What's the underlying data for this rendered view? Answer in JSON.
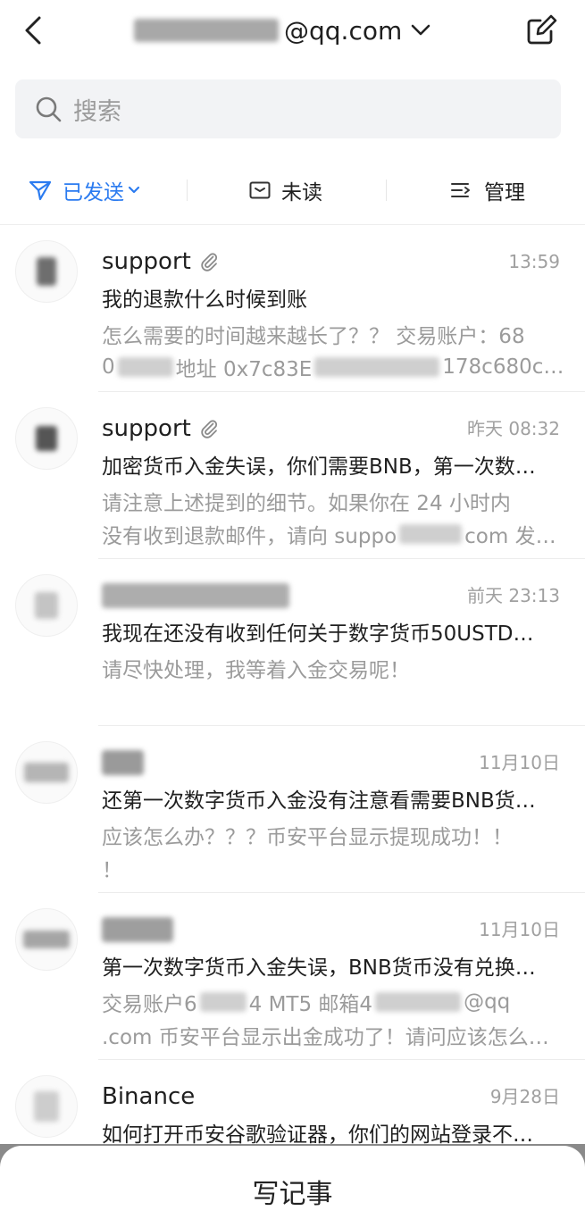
{
  "header": {
    "account_visible": "@qq.com"
  },
  "search": {
    "placeholder": "搜索"
  },
  "filters": {
    "sent": "已发送",
    "unread": "未读",
    "manage": "管理"
  },
  "mails": [
    {
      "sender": "support",
      "time": "13:59",
      "subject": "我的退款什么时候到账",
      "preview": [
        [
          "怎么需要的时间越来越长了？？ 交易账户：68"
        ],
        [
          "0",
          "地址 0x7c83E",
          "178c680c…"
        ]
      ]
    },
    {
      "sender": "support",
      "time": "昨天 08:32",
      "subject": "加密货币入金失误，你们需要BNB，第一次数…",
      "preview": [
        [
          "请注意上述提到的细节。如果你在 24 小时内"
        ],
        [
          "没有收到退款邮件，请向 suppo",
          "com 发…"
        ]
      ]
    },
    {
      "time": "前天 23:13",
      "subject": "我现在还没有收到任何关于数字货币50USTD…",
      "preview": [
        [
          "请尽快处理，我等着入金交易呢！"
        ]
      ]
    },
    {
      "time": "11月10日",
      "subject": "还第一次数字货币入金没有注意看需要BNB货…",
      "preview": [
        [
          "应该怎么办？？？币安平台显示提现成功！！"
        ],
        [
          "！"
        ]
      ]
    },
    {
      "time": "11月10日",
      "subject": "第一次数字货币入金失误，BNB货币没有兑换…",
      "preview": [
        [
          "交易账户6",
          "4  MT5 邮箱4",
          "@qq"
        ],
        [
          ".com 币安平台显示出金成功了！请问应该怎么…"
        ]
      ]
    },
    {
      "sender": "Binance",
      "time": "9月28日",
      "subject": "如何打开币安谷歌验证器，你们的网站登录不…"
    }
  ],
  "bottom_sheet": {
    "action_label": "写记事"
  },
  "icons": {
    "back": "chevron-left-icon",
    "account_menu": "chevron-down-icon",
    "compose": "compose-icon",
    "search": "search-icon",
    "sent": "paper-plane-icon",
    "unread": "envelope-icon",
    "manage": "list-manage-icon",
    "attachment": "paperclip-icon"
  },
  "colors": {
    "accent": "#2b7bf0",
    "text": "#1f1f1f",
    "muted": "#9b9b9b",
    "time": "#a0a0a0"
  }
}
